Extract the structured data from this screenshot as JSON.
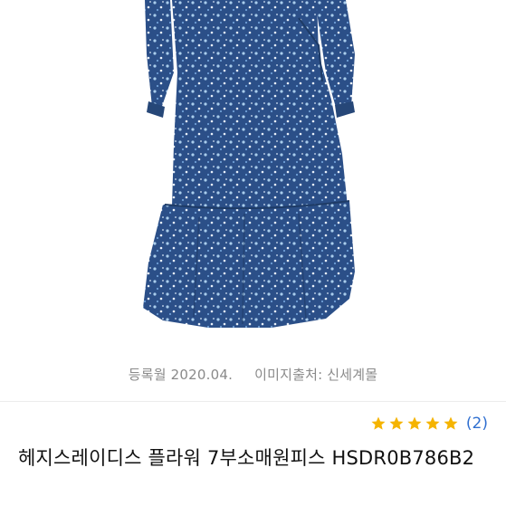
{
  "image": {
    "alt": "product-photo",
    "dress_color": "#2b4f88",
    "pattern_color": "#9cc3e6"
  },
  "meta": {
    "registered": "등록월 2020.04.",
    "source": "이미지출처: 신세계몰"
  },
  "rating": {
    "stars": 5,
    "star_color": "#f5b400",
    "review_count": "(2)"
  },
  "product": {
    "title": "헤지스레이디스 플라워 7부소매원피스 HSDR0B786B2"
  }
}
